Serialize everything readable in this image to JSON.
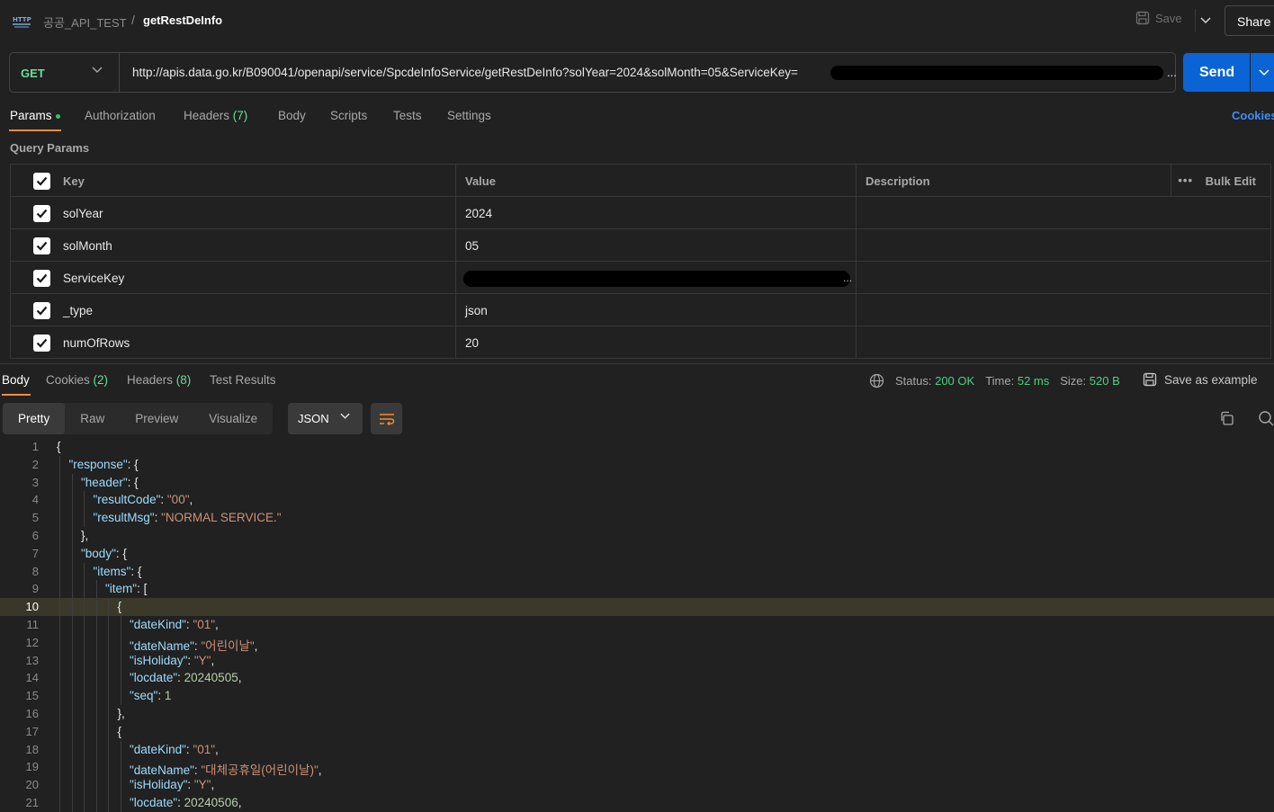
{
  "breadcrumb": {
    "collection": "공공_API_TEST",
    "separator": "/",
    "request": "getRestDeInfo"
  },
  "toolbar": {
    "save_label": "Save",
    "share_label": "Share"
  },
  "request": {
    "method": "GET",
    "url": "http://apis.data.go.kr/B090041/openapi/service/SpcdeInfoService/getRestDeInfo?solYear=2024&solMonth=05&ServiceKey=",
    "url_ellipsis": "...",
    "send_label": "Send"
  },
  "request_tabs": {
    "params": "Params",
    "authorization": "Authorization",
    "headers": "Headers",
    "headers_count": "(7)",
    "body": "Body",
    "scripts": "Scripts",
    "tests": "Tests",
    "settings": "Settings",
    "cookies": "Cookies"
  },
  "query_params": {
    "title": "Query Params",
    "columns": {
      "key": "Key",
      "value": "Value",
      "description": "Description"
    },
    "bulk_edit": "Bulk Edit",
    "bulk_dots": "•••",
    "rows": [
      {
        "key": "solYear",
        "value": "2024"
      },
      {
        "key": "solMonth",
        "value": "05"
      },
      {
        "key": "ServiceKey",
        "value": "...",
        "redacted": true
      },
      {
        "key": "_type",
        "value": "json"
      },
      {
        "key": "numOfRows",
        "value": "20"
      }
    ]
  },
  "response_tabs": {
    "body": "Body",
    "cookies": "Cookies",
    "cookies_count": "(2)",
    "headers": "Headers",
    "headers_count": "(8)",
    "test_results": "Test Results"
  },
  "status": {
    "status_label": "Status:",
    "status_value": "200 OK",
    "time_label": "Time:",
    "time_value": "52 ms",
    "size_label": "Size:",
    "size_value": "520 B",
    "save_example": "Save as example"
  },
  "view_modes": {
    "pretty": "Pretty",
    "raw": "Raw",
    "preview": "Preview",
    "visualize": "Visualize",
    "format": "JSON"
  },
  "colors": {
    "accent_orange": "#f08c3a",
    "send_blue": "#0a64d6",
    "status_green": "#4fd082",
    "method_green": "#6bdd9a",
    "highlight_line": "#38372a"
  },
  "highlighted_line": 10,
  "code_lines": [
    {
      "n": "1",
      "indent": 0,
      "tokens": [
        [
          "p",
          "{"
        ]
      ]
    },
    {
      "n": "2",
      "indent": 1,
      "tokens": [
        [
          "k",
          "\"response\""
        ],
        [
          "p",
          ": {"
        ]
      ]
    },
    {
      "n": "3",
      "indent": 2,
      "tokens": [
        [
          "k",
          "\"header\""
        ],
        [
          "p",
          ": {"
        ]
      ]
    },
    {
      "n": "4",
      "indent": 3,
      "tokens": [
        [
          "k",
          "\"resultCode\""
        ],
        [
          "p",
          ": "
        ],
        [
          "s",
          "\"00\""
        ],
        [
          "p",
          ","
        ]
      ]
    },
    {
      "n": "5",
      "indent": 3,
      "tokens": [
        [
          "k",
          "\"resultMsg\""
        ],
        [
          "p",
          ": "
        ],
        [
          "s",
          "\"NORMAL SERVICE.\""
        ]
      ]
    },
    {
      "n": "6",
      "indent": 2,
      "tokens": [
        [
          "p",
          "},"
        ]
      ]
    },
    {
      "n": "7",
      "indent": 2,
      "tokens": [
        [
          "k",
          "\"body\""
        ],
        [
          "p",
          ": {"
        ]
      ]
    },
    {
      "n": "8",
      "indent": 3,
      "tokens": [
        [
          "k",
          "\"items\""
        ],
        [
          "p",
          ": {"
        ]
      ]
    },
    {
      "n": "9",
      "indent": 4,
      "tokens": [
        [
          "k",
          "\"item\""
        ],
        [
          "p",
          ": ["
        ]
      ]
    },
    {
      "n": "10",
      "indent": 5,
      "tokens": [
        [
          "p",
          "{"
        ]
      ]
    },
    {
      "n": "11",
      "indent": 6,
      "tokens": [
        [
          "k",
          "\"dateKind\""
        ],
        [
          "p",
          ": "
        ],
        [
          "s",
          "\"01\""
        ],
        [
          "p",
          ","
        ]
      ]
    },
    {
      "n": "12",
      "indent": 6,
      "tokens": [
        [
          "k",
          "\"dateName\""
        ],
        [
          "p",
          ": "
        ],
        [
          "s",
          "\"어린이날\""
        ],
        [
          "p",
          ","
        ]
      ]
    },
    {
      "n": "13",
      "indent": 6,
      "tokens": [
        [
          "k",
          "\"isHoliday\""
        ],
        [
          "p",
          ": "
        ],
        [
          "s",
          "\"Y\""
        ],
        [
          "p",
          ","
        ]
      ]
    },
    {
      "n": "14",
      "indent": 6,
      "tokens": [
        [
          "k",
          "\"locdate\""
        ],
        [
          "p",
          ": "
        ],
        [
          "n",
          "20240505"
        ],
        [
          "p",
          ","
        ]
      ]
    },
    {
      "n": "15",
      "indent": 6,
      "tokens": [
        [
          "k",
          "\"seq\""
        ],
        [
          "p",
          ": "
        ],
        [
          "n",
          "1"
        ]
      ]
    },
    {
      "n": "16",
      "indent": 5,
      "tokens": [
        [
          "p",
          "},"
        ]
      ]
    },
    {
      "n": "17",
      "indent": 5,
      "tokens": [
        [
          "p",
          "{"
        ]
      ]
    },
    {
      "n": "18",
      "indent": 6,
      "tokens": [
        [
          "k",
          "\"dateKind\""
        ],
        [
          "p",
          ": "
        ],
        [
          "s",
          "\"01\""
        ],
        [
          "p",
          ","
        ]
      ]
    },
    {
      "n": "19",
      "indent": 6,
      "tokens": [
        [
          "k",
          "\"dateName\""
        ],
        [
          "p",
          ": "
        ],
        [
          "s",
          "\"대체공휴일(어린이날)\""
        ],
        [
          "p",
          ","
        ]
      ]
    },
    {
      "n": "20",
      "indent": 6,
      "tokens": [
        [
          "k",
          "\"isHoliday\""
        ],
        [
          "p",
          ": "
        ],
        [
          "s",
          "\"Y\""
        ],
        [
          "p",
          ","
        ]
      ]
    },
    {
      "n": "21",
      "indent": 6,
      "tokens": [
        [
          "k",
          "\"locdate\""
        ],
        [
          "p",
          ": "
        ],
        [
          "n",
          "20240506"
        ],
        [
          "p",
          ","
        ]
      ]
    }
  ]
}
